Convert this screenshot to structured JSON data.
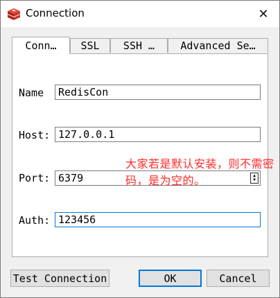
{
  "window": {
    "title": "Connection",
    "close_glyph": "✕",
    "icon": "redis-icon"
  },
  "tabs": [
    {
      "label": "Conn…",
      "active": true
    },
    {
      "label": "SSL",
      "active": false
    },
    {
      "label": "SSH …",
      "active": false
    },
    {
      "label": "Advanced Se…",
      "active": false
    }
  ],
  "form": {
    "name_label": "Name",
    "name_value": "RedisCon",
    "host_label": "Host:",
    "host_value": "127.0.0.1",
    "port_label": "Port:",
    "port_value": "6379",
    "auth_label": "Auth:",
    "auth_value": "123456"
  },
  "annotation": {
    "text": "大家若是默认安装，则不需密码，是为空的。",
    "color": "#ff2a2a"
  },
  "buttons": {
    "test_label": "Test Connection",
    "ok_label": "OK",
    "cancel_label": "Cancel"
  },
  "colors": {
    "focus_border": "#0078d7"
  }
}
